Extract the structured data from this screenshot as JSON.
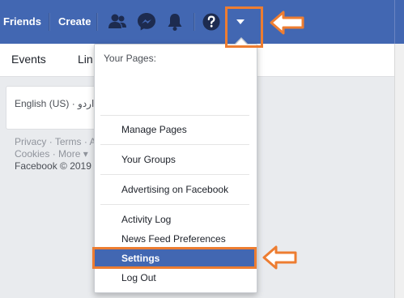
{
  "topbar": {
    "friends_label": "Friends",
    "create_label": "Create",
    "icons": [
      "friend-requests-icon",
      "messenger-icon",
      "notifications-icon",
      "help-icon",
      "account-menu-caret-icon"
    ],
    "color": "#4267b2"
  },
  "subnav": {
    "events_label": "Events",
    "partial_label": "Lin"
  },
  "language": {
    "text": "English (US) · اردو"
  },
  "footer": {
    "privacy": "Privacy",
    "terms": "Terms",
    "terms_tail": "A",
    "cookies": "Cookies",
    "more": "More",
    "copyright": "Facebook © 2019"
  },
  "dropdown": {
    "header": "Your Pages:",
    "items": [
      {
        "label": "Manage Pages"
      },
      {
        "label": "Your Groups"
      },
      {
        "label": "Advertising on Facebook"
      },
      {
        "label": "Activity Log"
      },
      {
        "label": "News Feed Preferences"
      },
      {
        "label": "Settings"
      },
      {
        "label": "Log Out"
      }
    ],
    "highlight_color": "#4267b2"
  },
  "annotation": {
    "color": "#ed7d31"
  }
}
